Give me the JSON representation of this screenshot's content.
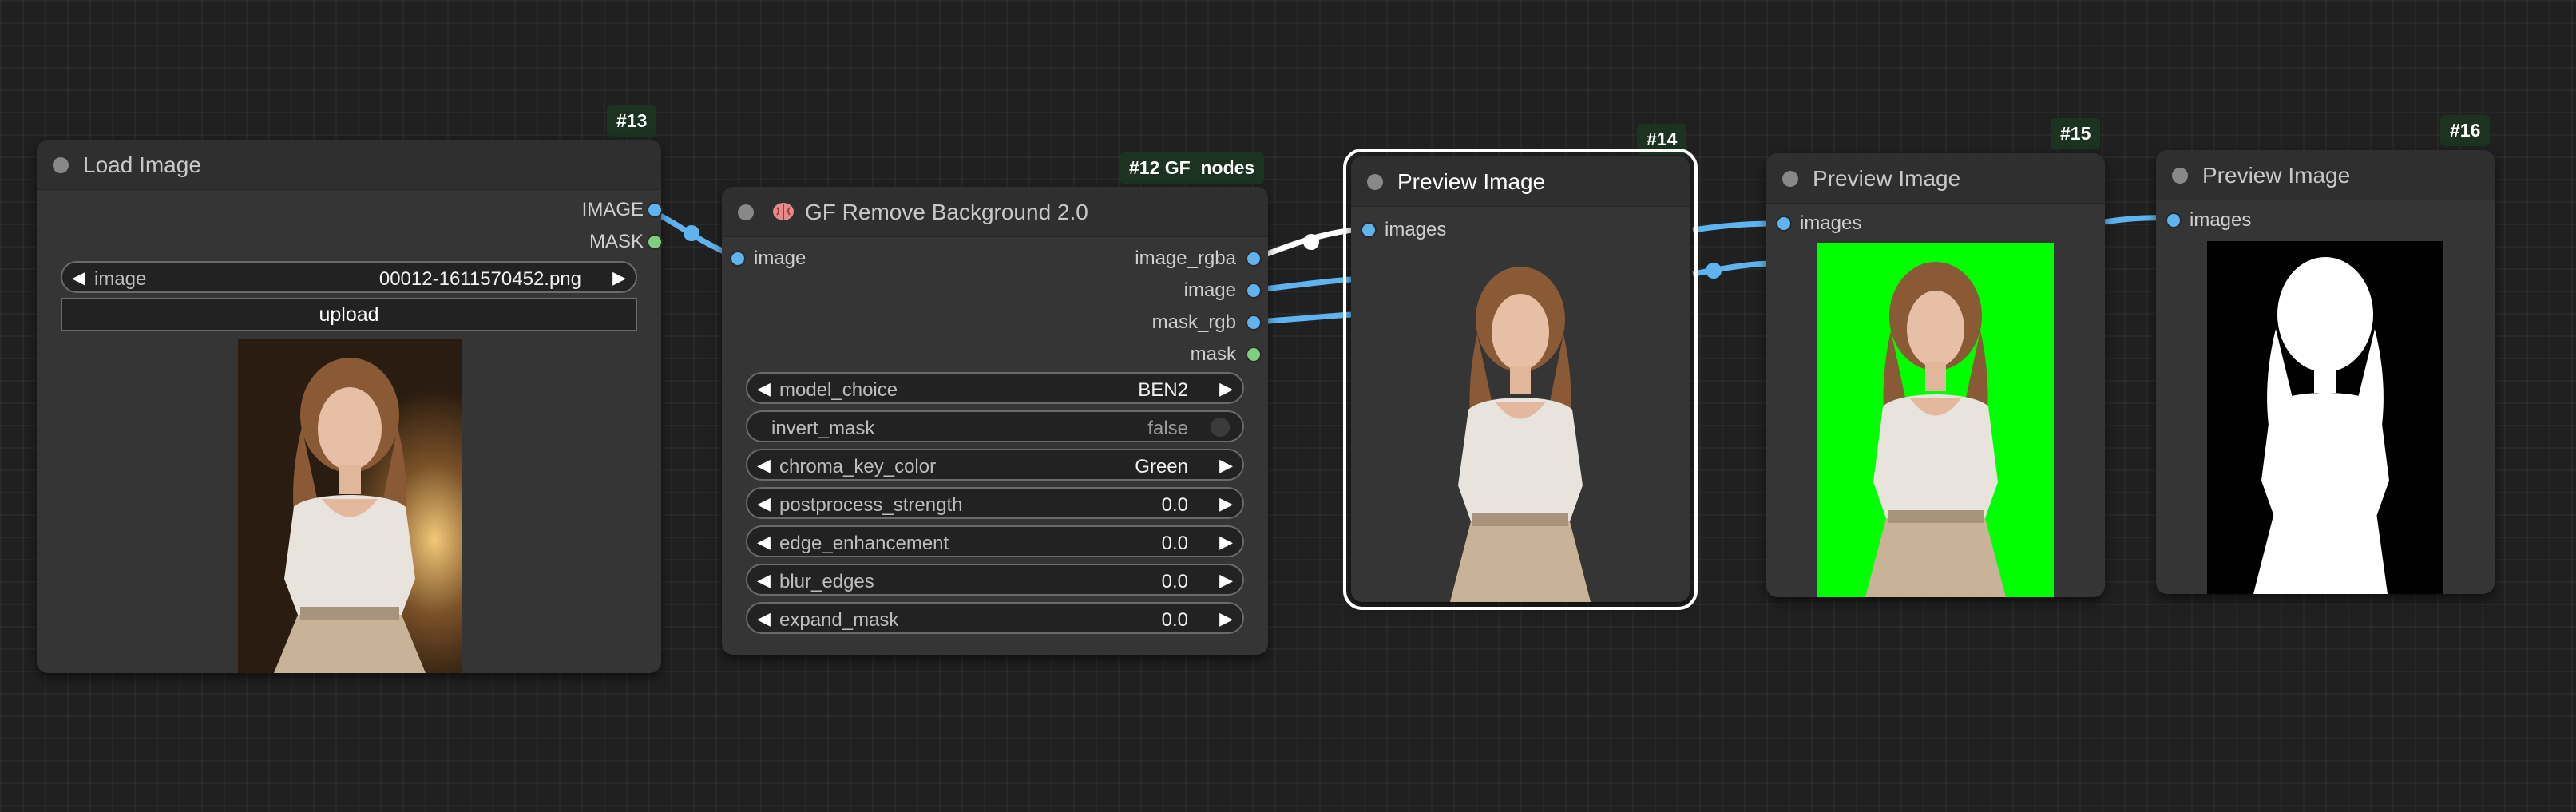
{
  "colors": {
    "canvas_bg": "#202020",
    "node_bg": "#353535",
    "image_slot": "#5fb4f0",
    "mask_slot": "#7fcf7f",
    "wire_image": "#5fb4f0",
    "wire_white": "#ffffff",
    "badge_bg": "#1b3320",
    "green_screen": "#00ff00"
  },
  "nodes": {
    "load_image": {
      "badge": "#13",
      "title": "Load Image",
      "outputs": [
        "IMAGE",
        "MASK"
      ],
      "image_widget": {
        "label": "image",
        "value": "00012-1611570452.png"
      },
      "upload_label": "upload"
    },
    "remove_bg": {
      "badge": "#12 GF_nodes",
      "title": "GF Remove Background 2.0",
      "title_icon": "brain-icon",
      "input": "image",
      "outputs": [
        "image_rgba",
        "image",
        "mask_rgb",
        "mask"
      ],
      "widgets": [
        {
          "label": "model_choice",
          "value": "BEN2"
        },
        {
          "label": "invert_mask",
          "value": "false"
        },
        {
          "label": "chroma_key_color",
          "value": "Green"
        },
        {
          "label": "postprocess_strength",
          "value": "0.0"
        },
        {
          "label": "edge_enhancement",
          "value": "0.0"
        },
        {
          "label": "blur_edges",
          "value": "0.0"
        },
        {
          "label": "expand_mask",
          "value": "0.0"
        }
      ]
    },
    "preview_14": {
      "badge": "#14",
      "title": "Preview Image",
      "input": "images"
    },
    "preview_15": {
      "badge": "#15",
      "title": "Preview Image",
      "input": "images"
    },
    "preview_16": {
      "badge": "#16",
      "title": "Preview Image",
      "input": "images"
    }
  }
}
